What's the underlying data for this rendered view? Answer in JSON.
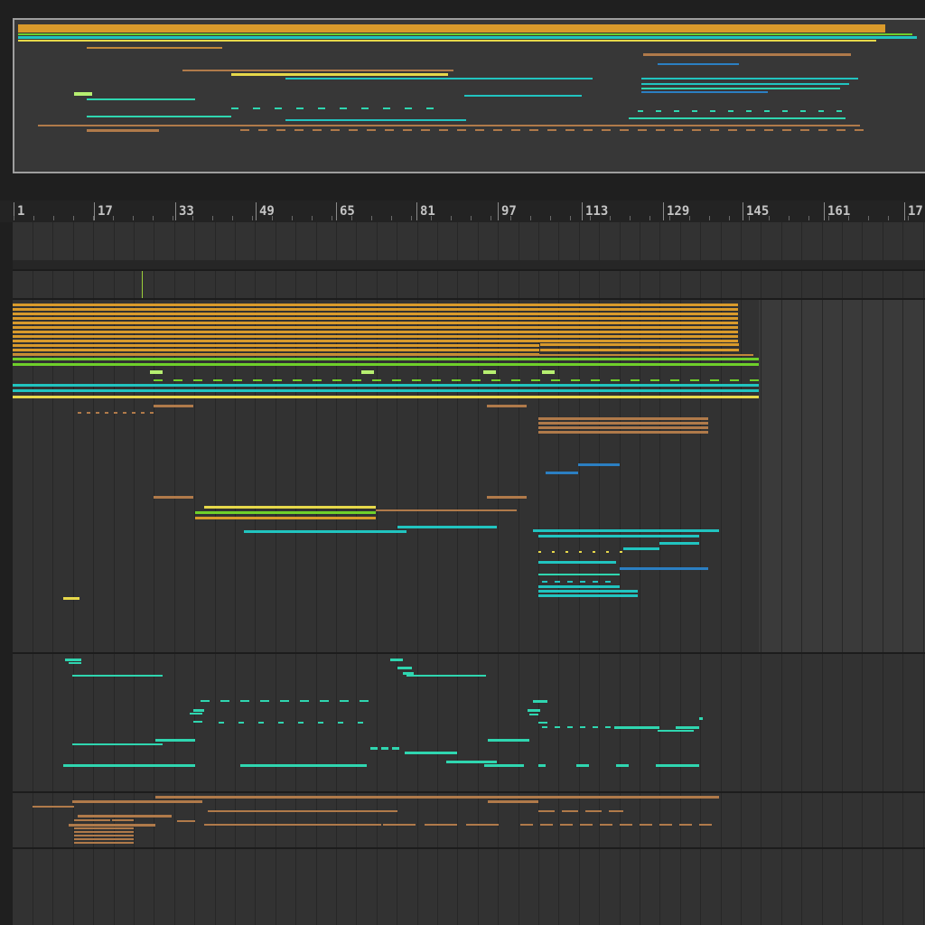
{
  "ruler": {
    "bars": [
      "1",
      "17",
      "33",
      "49",
      "65",
      "81",
      "97",
      "113",
      "129",
      "145",
      "161",
      "17"
    ]
  },
  "colors": {
    "orange": "#d99a2b",
    "orange_dim": "#c1873a",
    "green": "#6fd02a",
    "light_green": "#b6ef70",
    "cyan": "#21c4c0",
    "teal": "#2fd6b0",
    "yellow": "#e6d84a",
    "blue": "#2b7fc2",
    "tan": "#b07a4a",
    "lime": "#9bcf3a"
  }
}
